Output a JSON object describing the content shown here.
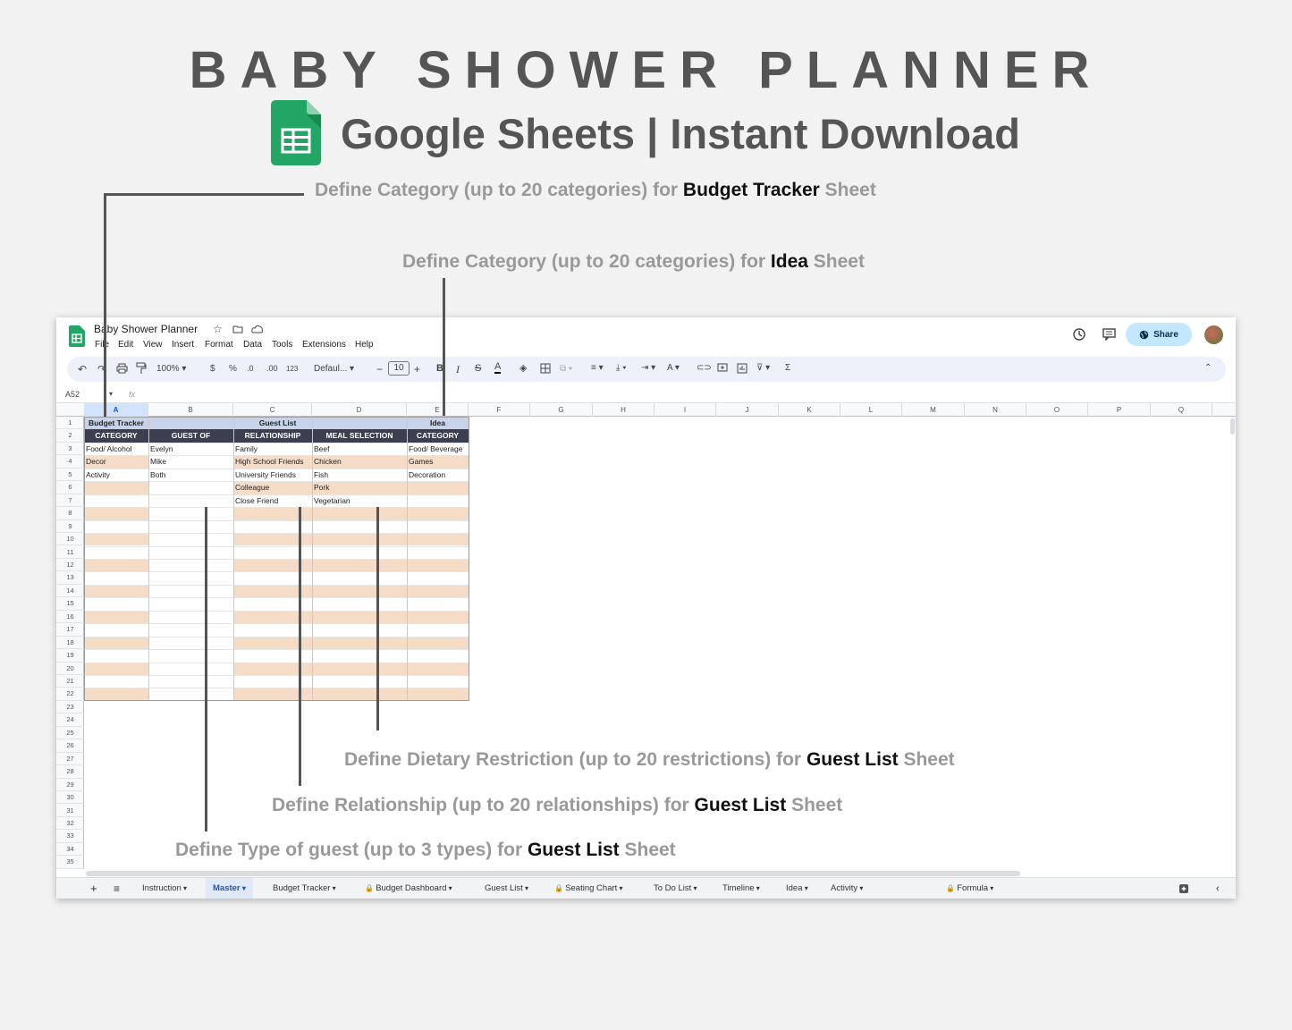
{
  "banner": {
    "title": "BABY SHOWER PLANNER",
    "subtitle": "Google Sheets | Instant Download"
  },
  "annotations": {
    "budget": {
      "pre": "Define Category  (up to 20 categories) for ",
      "bold": "Budget Tracker",
      "post": " Sheet"
    },
    "idea": {
      "pre": "Define Category (up to 20 categories) for ",
      "bold": "Idea",
      "post": " Sheet"
    },
    "dietary": {
      "pre": "Define Dietary Restriction (up to 20 restrictions) for ",
      "bold": "Guest List",
      "post": " Sheet"
    },
    "relationship": {
      "pre": "Define Relationship  (up to 20 relationships) for ",
      "bold": "Guest List",
      "post": " Sheet"
    },
    "guest_type": {
      "pre": "Define Type of guest  (up to 3 types) for ",
      "bold": "Guest List",
      "post": " Sheet"
    }
  },
  "app": {
    "doc_title": "Baby Shower Planner",
    "menu": [
      "File",
      "Edit",
      "View",
      "Insert",
      "Format",
      "Data",
      "Tools",
      "Extensions",
      "Help"
    ],
    "share_label": "Share",
    "toolbar": {
      "zoom": "100%",
      "currency": "$",
      "percent": "%",
      "dec_less": ".0",
      "dec_more": ".00",
      "number_format": "123",
      "font": "Defaul...",
      "font_size": "10",
      "minus": "−",
      "plus": "+"
    },
    "name_box": "A52",
    "fx": "fx"
  },
  "grid": {
    "columns": [
      "A",
      "B",
      "C",
      "D",
      "E",
      "F",
      "G",
      "H",
      "I",
      "J",
      "K",
      "L",
      "M",
      "N",
      "O",
      "P",
      "Q"
    ],
    "row_count": 35,
    "group_headers": {
      "budget": "Budget Tracker",
      "guest": "Guest List",
      "idea": "Idea"
    },
    "headers": [
      "CATEGORY",
      "GUEST OF",
      "RELATIONSHIP",
      "MEAL SELECTION",
      "CATEGORY"
    ],
    "budget_categories": [
      "Food/ Alcohol",
      "Decor",
      "Activity"
    ],
    "guest_of": [
      "Evelyn",
      "Mike",
      "Both"
    ],
    "relationships": [
      "Family",
      "High School Friends",
      "University Friends",
      "Colleague",
      "Close Friend"
    ],
    "meals": [
      "Beef",
      "Chicken",
      "Fish",
      "Pork",
      "Vegetarian"
    ],
    "idea_categories": [
      "Food/ Beverage",
      "Games",
      "Decoration"
    ]
  },
  "tabs": [
    {
      "label": "Instruction",
      "locked": false,
      "active": false
    },
    {
      "label": "Master",
      "locked": false,
      "active": true
    },
    {
      "label": "Budget Tracker",
      "locked": false,
      "active": false
    },
    {
      "label": "Budget Dashboard",
      "locked": true,
      "active": false
    },
    {
      "label": "Guest List",
      "locked": false,
      "active": false
    },
    {
      "label": "Seating Chart",
      "locked": true,
      "active": false
    },
    {
      "label": "To Do List",
      "locked": false,
      "active": false
    },
    {
      "label": "Timeline",
      "locked": false,
      "active": false
    },
    {
      "label": "Idea",
      "locked": false,
      "active": false
    },
    {
      "label": "Activity",
      "locked": false,
      "active": false
    },
    {
      "label": "Formula",
      "locked": true,
      "active": false
    }
  ]
}
